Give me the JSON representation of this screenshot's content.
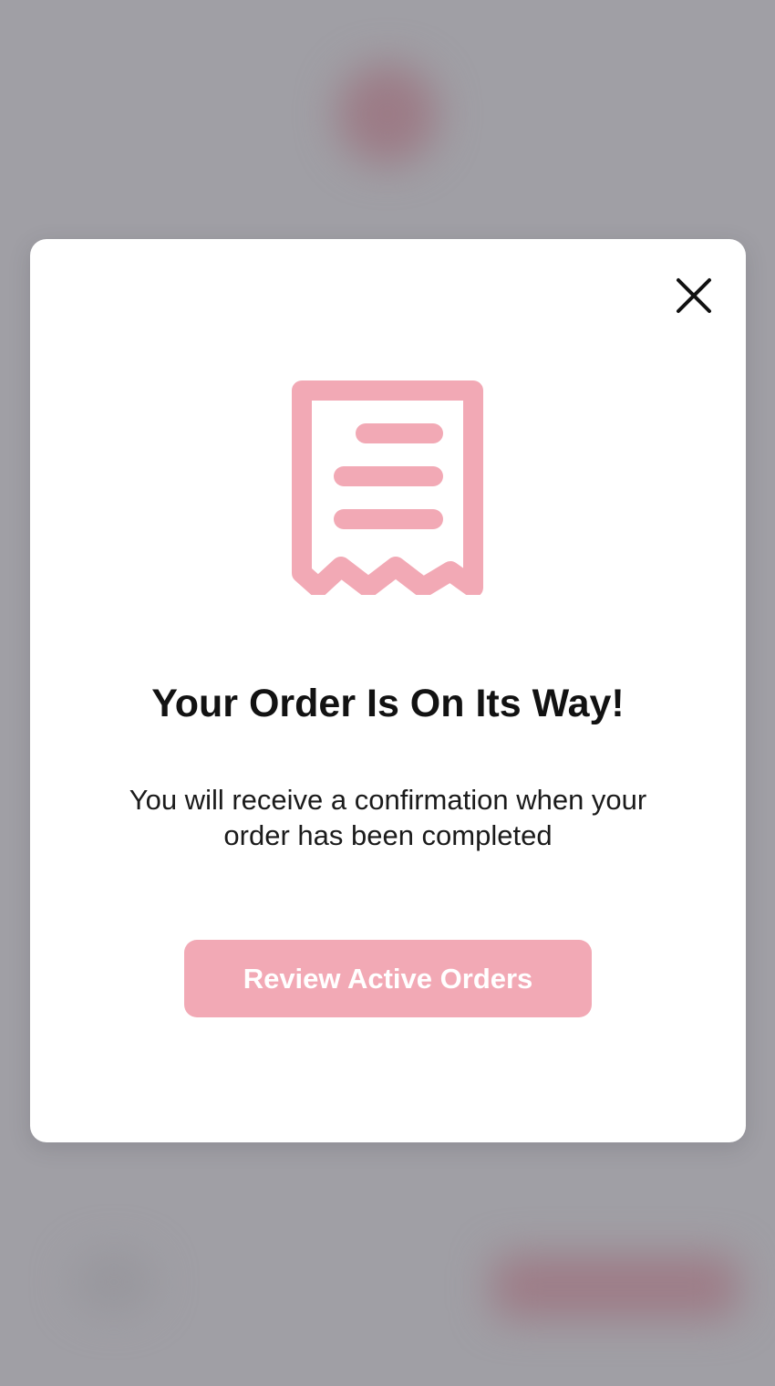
{
  "modal": {
    "title": "Your Order Is On Its Way!",
    "message": "You will receive a confirmation when your order has been completed",
    "primary_button_label": "Review Active Orders",
    "icon": "receipt-icon",
    "close_icon": "close-icon"
  },
  "colors": {
    "accent": "#f2a9b5",
    "overlay": "#a09fa5",
    "background_accent_blur": "#9c7b86",
    "title_text": "#121212",
    "close_icon": "#111111"
  }
}
